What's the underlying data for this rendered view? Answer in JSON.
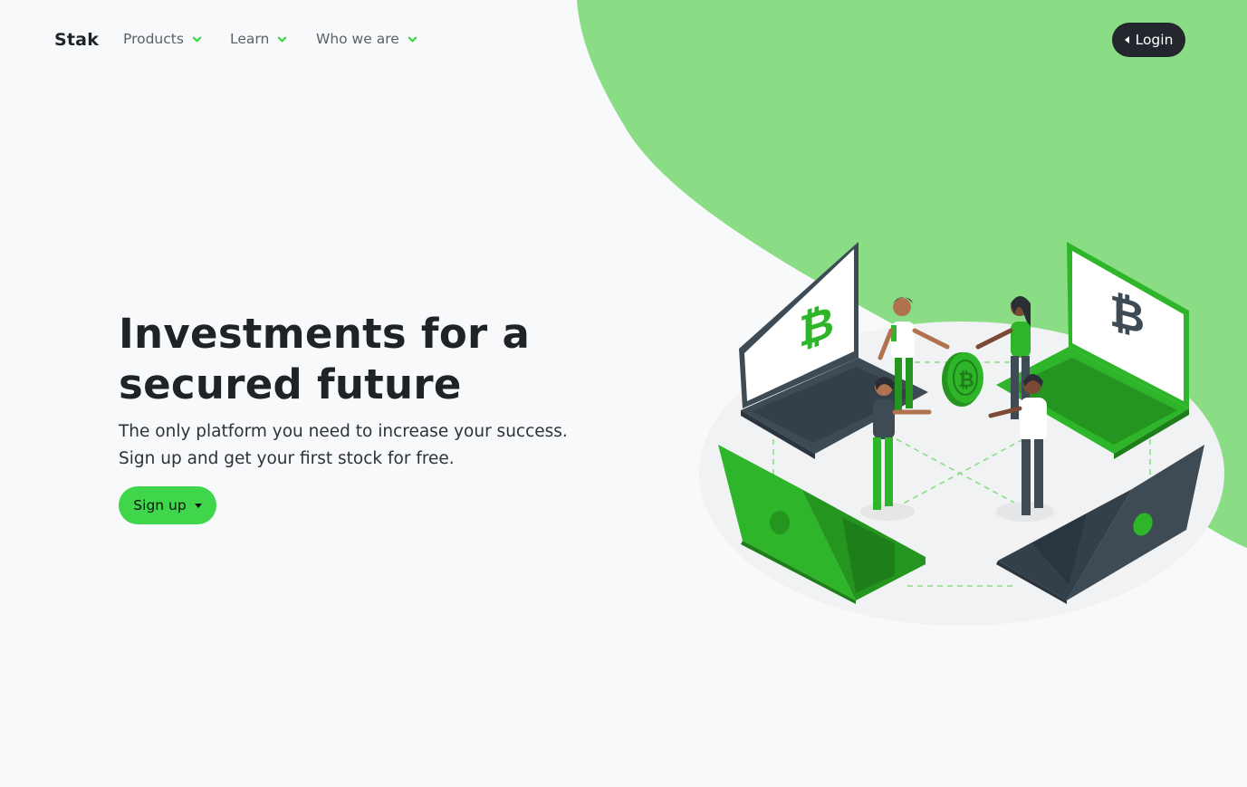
{
  "nav": {
    "brand": "Stak",
    "menu": [
      {
        "label": "Products"
      },
      {
        "label": "Learn"
      },
      {
        "label": "Who we are"
      }
    ],
    "login_label": "Login"
  },
  "hero": {
    "title_line1": "Investments for a",
    "title_line2": "secured future",
    "subtitle_line1": "The only platform you need to increase your success.",
    "subtitle_line2": "Sign up and get your first stock for free.",
    "cta_label": "Sign up"
  },
  "colors": {
    "accent": "#3fd64c",
    "blob": "#8add85",
    "dark": "#23262c",
    "laptop_dark": "#3e4b54",
    "laptop_green": "#2fb52a"
  }
}
